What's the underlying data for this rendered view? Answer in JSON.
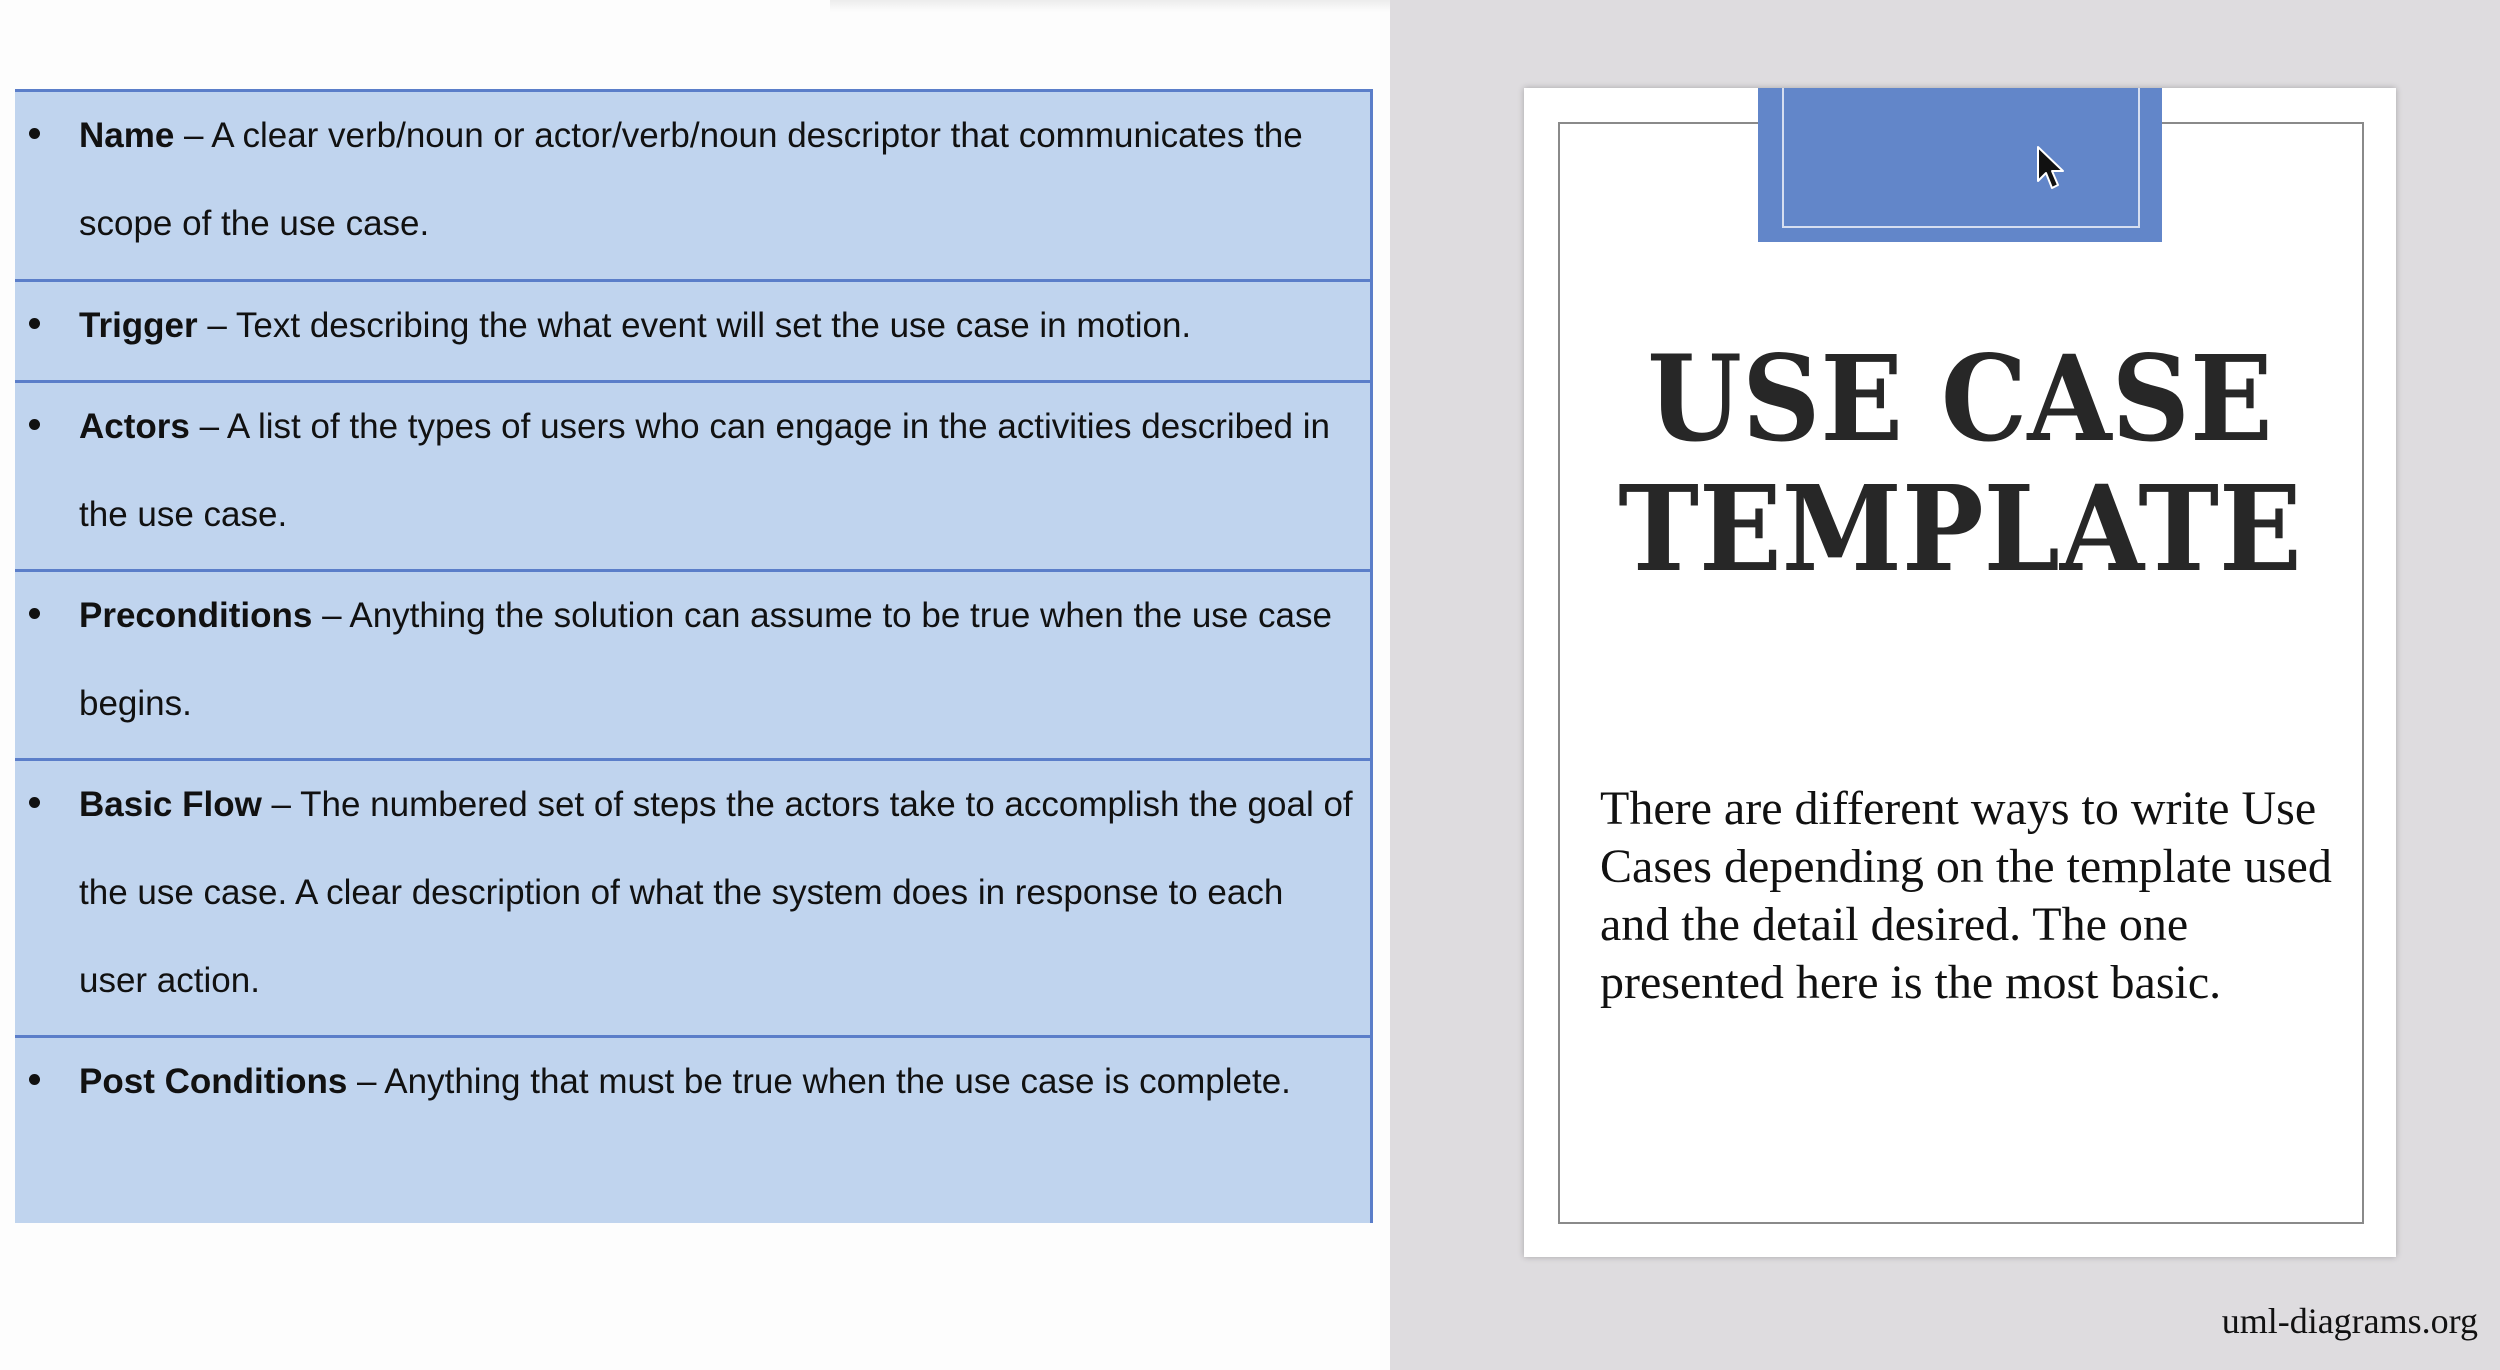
{
  "definitions": [
    {
      "term": "Name",
      "text": " – A clear verb/noun or actor/verb/noun descriptor that communicates the scope of the use case."
    },
    {
      "term": "Trigger",
      "text": " – Text describing the what event will set the use case in motion."
    },
    {
      "term": "Actors",
      "text": " – A list of the types of users who can engage in the activities described in the use case."
    },
    {
      "term": "Preconditions",
      "text": " – Anything the solution can assume to be true when the use case begins."
    },
    {
      "term": "Basic Flow",
      "text": " – The numbered set of steps the actors take to accomplish the goal of the use case. A clear description of what the system does in response to each user action."
    },
    {
      "term": "Post Conditions",
      "text": " – Anything that must be true when the use case is complete."
    }
  ],
  "document": {
    "title_line1": "USE CASE",
    "title_line2": "TEMPLATE",
    "body": "There are different ways to write Use Cases depending on the template used and the detail desired. The one presented here is the most basic."
  },
  "footer": {
    "site": "uml-diagrams.org"
  },
  "colors": {
    "table_fill": "#c0d4ee",
    "table_border": "#5b7ec9",
    "tab_fill": "#6286c9",
    "title_text": "#272727"
  },
  "icons": {
    "cursor": "mouse-pointer-icon",
    "bullet": "bullet-icon"
  }
}
